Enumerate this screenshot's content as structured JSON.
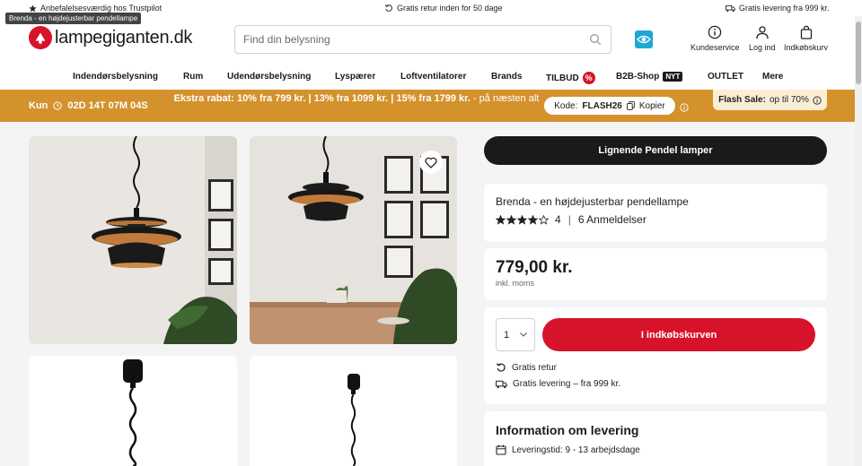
{
  "topbar": {
    "trust": "Anbefalelsesværdig hos Trustpilot",
    "returns": "Gratis retur inden for 50 dage",
    "delivery": "Gratis levering fra 999 kr.",
    "tooltip": "Brenda - en højdejusterbar pendellampe"
  },
  "header": {
    "logo": "lampegiganten.dk",
    "search_placeholder": "Find din belysning",
    "customer_service": "Kundeservice",
    "login": "Log ind",
    "cart": "Indkøbskurv"
  },
  "nav": {
    "items": [
      "Indendørsbelysning",
      "Rum",
      "Udendørsbelysning",
      "Lyspærer",
      "Loftventilatorer",
      "Brands",
      "TILBUD",
      "B2B-Shop",
      "OUTLET",
      "Mere"
    ],
    "tilbud_badge": "%",
    "b2b_badge": "NYT"
  },
  "promo": {
    "prefix": "Kun",
    "countdown": "02D 14T 07M 04S",
    "message_bold": "Ekstra rabat: 10% fra 799 kr. | 13% fra 1099 kr. | 15% fra 1799 kr.",
    "message_rest": " - på næsten alt",
    "code_label": "Kode:",
    "code": "FLASH26",
    "copy": "Kopier",
    "flash_bold": "Flash Sale:",
    "flash_rest": "op til 70%"
  },
  "product": {
    "similar_button": "Lignende Pendel lamper",
    "name": "Brenda - en højdejusterbar pendellampe",
    "rating_value": "4",
    "rating_stars": 4,
    "separator": "|",
    "reviews": "6 Anmeldelser",
    "price": "779,00 kr.",
    "vat": "inkl. moms",
    "quantity": "1",
    "add_to_cart": "I indkøbskurven",
    "free_return": "Gratis retur",
    "free_delivery": "Gratis levering – fra 999 kr."
  },
  "shipping": {
    "title": "Information om levering",
    "delivery_time": "Leveringstid: 9 - 13 arbejdsdage"
  },
  "colors": {
    "brand_red": "#d7132a",
    "promo_orange": "#d4922d",
    "dark": "#1a1a1a"
  }
}
